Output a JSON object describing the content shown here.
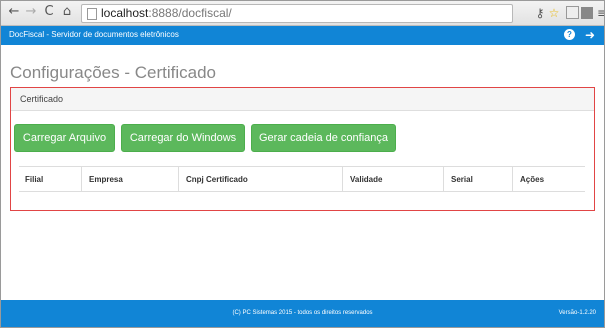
{
  "browser": {
    "url_host": "localhost",
    "url_port_path": ":8888/docfiscal/"
  },
  "navbar": {
    "title": "DocFiscal - Servidor de documentos eletrônicos",
    "help_label": "?",
    "logout_label": "➜"
  },
  "page": {
    "title": "Configurações - Certificado"
  },
  "panel": {
    "title": "Certificado",
    "buttons": {
      "load_file": "Carregar Arquivo",
      "load_windows": "Carregar do Windows",
      "trust_chain": "Gerar cadeia de confiança"
    },
    "table": {
      "columns": [
        "Filial",
        "Empresa",
        "Cnpj Certificado",
        "Validade",
        "Serial",
        "Ações"
      ],
      "rows": []
    }
  },
  "footer": {
    "copyright": "(C) PC Sistemas 2015 - todos os direitos reservados",
    "version": "Versão-1.2.20"
  },
  "colors": {
    "brand": "#1185d6",
    "button_green": "#5cb85c",
    "highlight_border": "#e14545"
  },
  "icons": {
    "back": "arrow-left-icon",
    "forward": "arrow-right-icon",
    "reload": "reload-icon",
    "home": "home-icon",
    "page": "page-icon",
    "key": "key-icon",
    "star": "star-icon",
    "menu": "menu-icon",
    "help": "help-icon",
    "logout": "logout-icon"
  }
}
